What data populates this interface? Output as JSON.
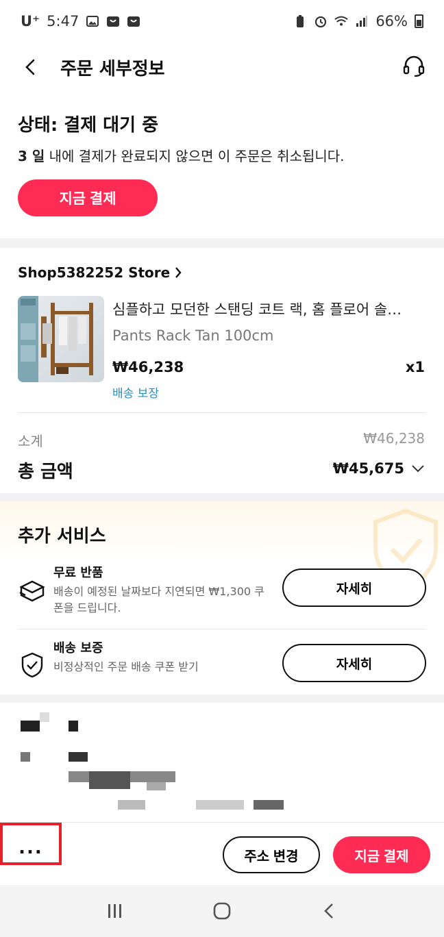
{
  "status_bar": {
    "carrier": "U⁺",
    "time": "5:47",
    "battery": "66%"
  },
  "header": {
    "title": "주문 세부정보"
  },
  "order_status": {
    "title": "상태: 결제 대기 중",
    "days": "3 일",
    "message": " 내에 결제가 완료되지 않으면 이 주문은 취소됩니다.",
    "pay_now": "지금 결제"
  },
  "order": {
    "store": "Shop5382252 Store",
    "product_name": "심플하고 모던한 스탠딩 코트 랙, 홈 플로어 솔…",
    "variant": "Pants Rack Tan 100cm",
    "price": "₩46,238",
    "quantity": "x1",
    "delivery_guarantee": "배송 보장",
    "subtotal_label": "소계",
    "subtotal_value": "₩46,238",
    "total_label": "총 금액",
    "total_value": "₩45,675"
  },
  "services": {
    "title": "추가 서비스",
    "items": [
      {
        "name": "무료 반품",
        "desc": "배송이 예정된 날짜보다 지연되면 ₩1,300 쿠폰을 드립니다.",
        "button": "자세히",
        "icon": "return-box-icon"
      },
      {
        "name": "배송 보증",
        "desc": "비정상적인 주문 배송 쿠폰 받기",
        "button": "자세히",
        "icon": "shield-check-icon"
      }
    ]
  },
  "bottom_bar": {
    "more": "...",
    "change_address": "주소 변경",
    "pay_now": "지금 결제"
  },
  "colors": {
    "primary": "#fe2c55",
    "link": "#2a8fbf",
    "highlight_box": "#e8202a"
  }
}
